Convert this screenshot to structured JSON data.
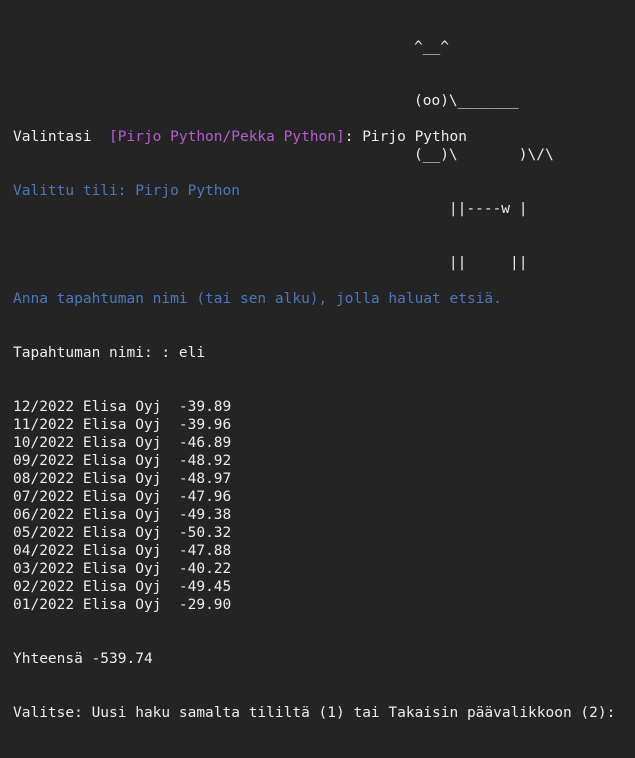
{
  "cow_art": [
    "^__^",
    "(oo)\\_______",
    "(__)\\       )\\/\\",
    "    ||----w |",
    "    ||     ||"
  ],
  "prompt": {
    "label": "Valintasi  ",
    "options": "[Pirjo Python/Pekka Python]",
    "separator": ": ",
    "answer": "Pirjo Python"
  },
  "selected_account": "Valittu tili: Pirjo Python",
  "search_instruction": "Anna tapahtuman nimi (tai sen alku), jolla haluat etsiä.",
  "search_input": {
    "label": "Tapahtuman nimi: : ",
    "value": "eli"
  },
  "results": [
    {
      "month": "12/2022",
      "name": "Elisa Oyj",
      "amount": "-39.89"
    },
    {
      "month": "11/2022",
      "name": "Elisa Oyj",
      "amount": "-39.96"
    },
    {
      "month": "10/2022",
      "name": "Elisa Oyj",
      "amount": "-46.89"
    },
    {
      "month": "09/2022",
      "name": "Elisa Oyj",
      "amount": "-48.92"
    },
    {
      "month": "08/2022",
      "name": "Elisa Oyj",
      "amount": "-48.97"
    },
    {
      "month": "07/2022",
      "name": "Elisa Oyj",
      "amount": "-47.96"
    },
    {
      "month": "06/2022",
      "name": "Elisa Oyj",
      "amount": "-49.38"
    },
    {
      "month": "05/2022",
      "name": "Elisa Oyj",
      "amount": "-50.32"
    },
    {
      "month": "04/2022",
      "name": "Elisa Oyj",
      "amount": "-47.88"
    },
    {
      "month": "03/2022",
      "name": "Elisa Oyj",
      "amount": "-40.22"
    },
    {
      "month": "02/2022",
      "name": "Elisa Oyj",
      "amount": "-49.45"
    },
    {
      "month": "01/2022",
      "name": "Elisa Oyj",
      "amount": "-29.90"
    }
  ],
  "total": "Yhteensä -539.74",
  "final_prompt": "Valitse: Uusi haku samalta tililtä (1) tai Takaisin päävalikkoon (2):",
  "colors": {
    "background": "#242424",
    "text": "#ececec",
    "options": "#b75cd1",
    "info": "#4a77bf"
  }
}
